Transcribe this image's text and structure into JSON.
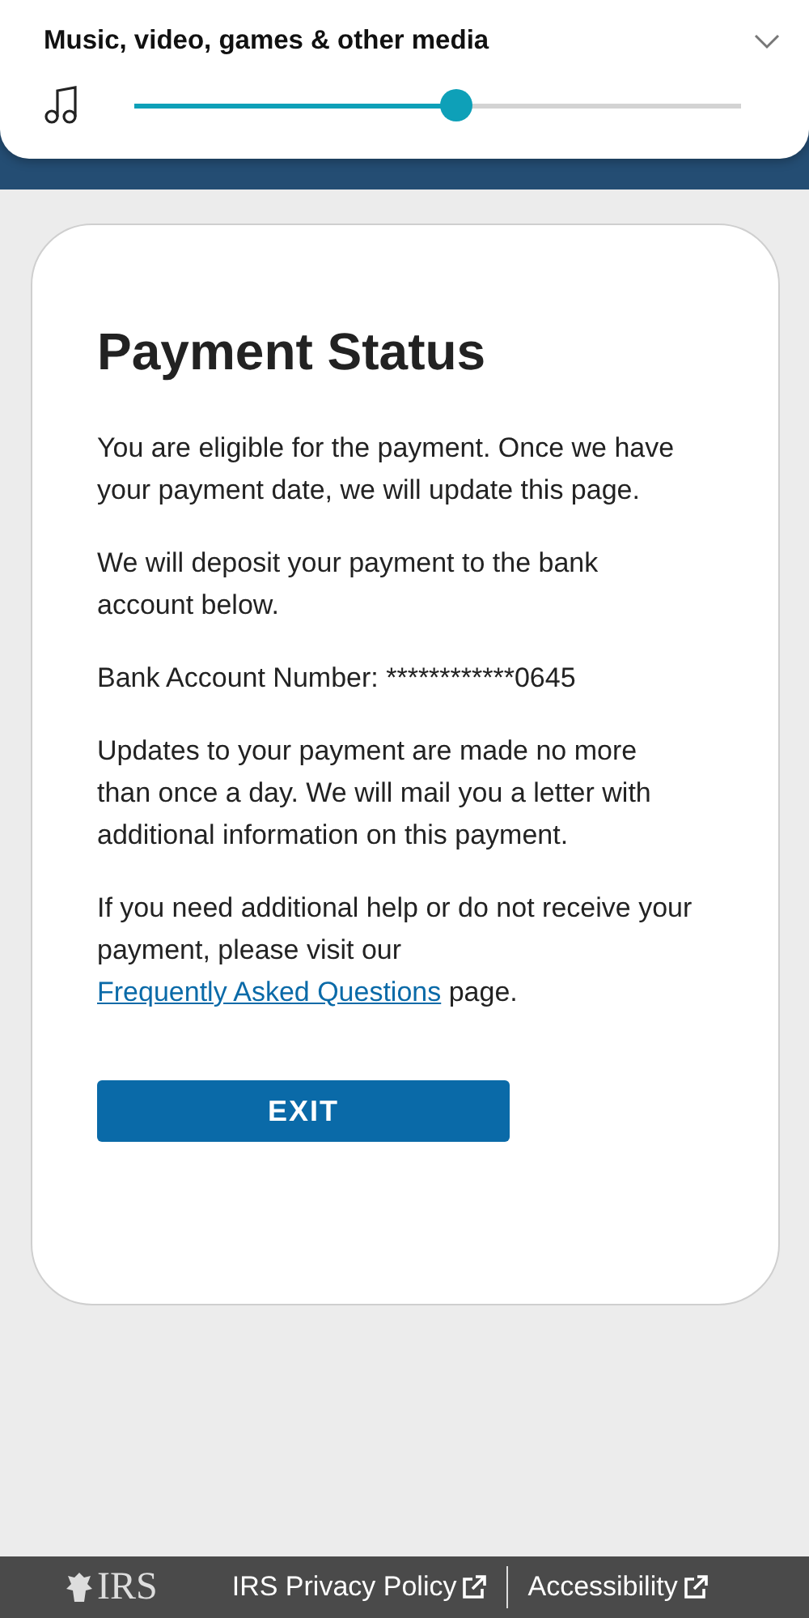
{
  "volume_panel": {
    "title": "Music, video, games & other media",
    "expanded": false,
    "level": 0.53
  },
  "card": {
    "title": "Payment Status",
    "paragraphs": [
      {
        "text": "You are eligible for the payment. Once we have your payment date, we will update this page."
      },
      {
        "text": "We will deposit your payment to the bank account below."
      },
      {
        "text": "Bank Account Number: ************0645"
      },
      {
        "text": "Updates to your payment are made no more than once a day. We will mail you a letter with additional information on this payment."
      },
      {
        "text": "If you need additional help or do not receive your payment, please visit our",
        "link": "Frequently Asked Questions",
        "after": "page."
      }
    ],
    "button": "EXIT"
  },
  "footer": {
    "logo": "IRS",
    "links": [
      {
        "label": "IRS Privacy Policy",
        "external": true
      },
      {
        "label": "Accessibility",
        "external": true
      }
    ]
  }
}
